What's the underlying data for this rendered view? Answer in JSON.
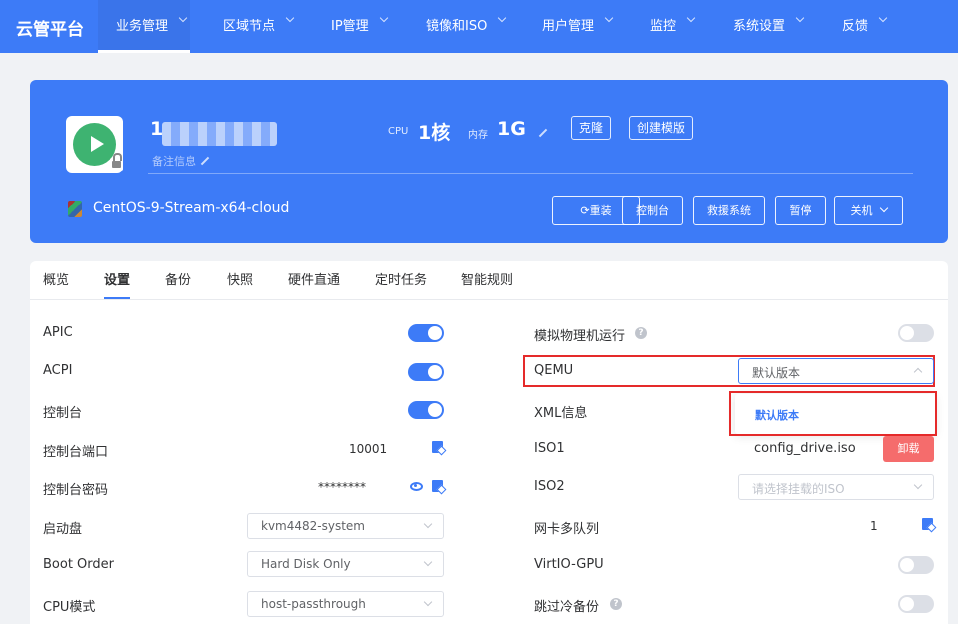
{
  "topnav": {
    "brand": "云管平台",
    "items": [
      {
        "label": "业务管理"
      },
      {
        "label": "区域节点"
      },
      {
        "label": "IP管理"
      },
      {
        "label": "镜像和ISO"
      },
      {
        "label": "用户管理"
      },
      {
        "label": "监控"
      },
      {
        "label": "系统设置"
      },
      {
        "label": "反馈"
      }
    ]
  },
  "vm": {
    "name": "1",
    "remark": "备注信息",
    "cpu_label": "CPU",
    "cpu_value": "1核",
    "mem_label": "内存",
    "mem_value": "1G",
    "clone_label": "克隆",
    "template_label": "创建模版",
    "os": "CentOS-9-Stream-x64-cloud",
    "actions": {
      "reinstall": "重装",
      "console": "控制台",
      "rescue": "救援系统",
      "pause": "暂停",
      "shutdown": "关机"
    }
  },
  "tabs": [
    "概览",
    "设置",
    "备份",
    "快照",
    "硬件直通",
    "定时任务",
    "智能规则"
  ],
  "left": {
    "apic": {
      "label": "APIC",
      "on": true
    },
    "acpi": {
      "label": "ACPI",
      "on": true
    },
    "console": {
      "label": "控制台",
      "on": true
    },
    "console_port": {
      "label": "控制台端口",
      "value": "10001"
    },
    "console_password": {
      "label": "控制台密码",
      "value": "********"
    },
    "boot_disk": {
      "label": "启动盘",
      "value": "kvm4482-system"
    },
    "boot_order": {
      "label": "Boot Order",
      "value": "Hard Disk Only"
    },
    "cpu_mode": {
      "label": "CPU模式",
      "value": "host-passthrough"
    }
  },
  "right": {
    "emulate": {
      "label": "模拟物理机运行",
      "on": false
    },
    "qemu": {
      "label": "QEMU",
      "value": "默认版本",
      "option": "默认版本"
    },
    "xml": {
      "label": "XML信息"
    },
    "iso1": {
      "label": "ISO1",
      "value": "config_drive.iso",
      "unmount": "卸载"
    },
    "iso2": {
      "label": "ISO2",
      "placeholder": "请选择挂载的ISO"
    },
    "nic_queue": {
      "label": "网卡多队列",
      "value": "1"
    },
    "virtio_gpu": {
      "label": "VirtIO-GPU",
      "on": false
    },
    "skip_cold_backup": {
      "label": "跳过冷备份",
      "on": false
    }
  },
  "colors": {
    "primary": "#3d7bf7",
    "success": "#3eb371",
    "danger": "#f56c6c",
    "highlight": "#e52a2a"
  }
}
